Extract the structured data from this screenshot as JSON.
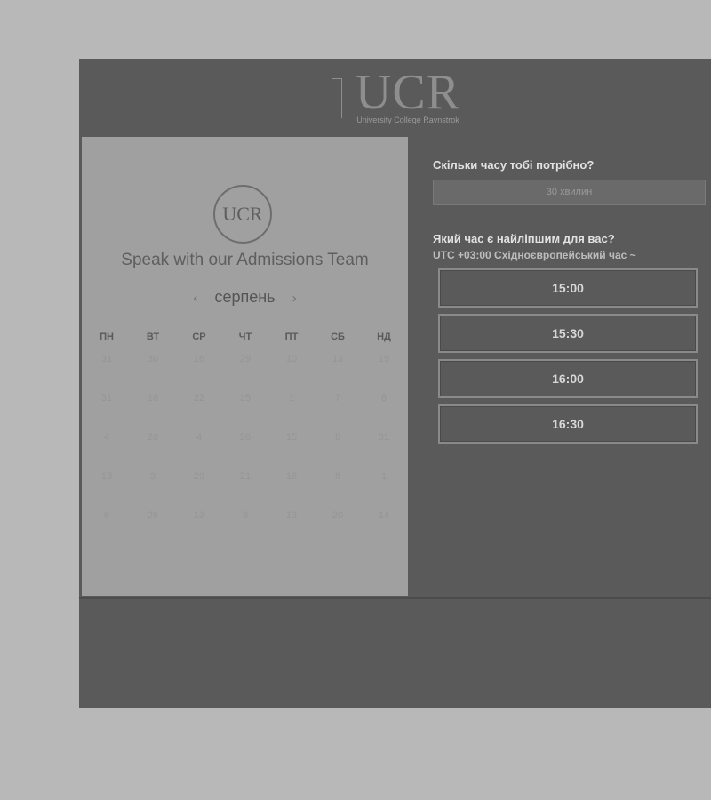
{
  "header": {
    "logo_text": "UCR",
    "logo_subtitle": "University College Ravnstrok"
  },
  "calendar": {
    "logo_text": "UCR",
    "title": "Speak with our Admissions Team",
    "month": "серпень",
    "prev_label": "‹",
    "next_label": "›",
    "weekdays": [
      "ПН",
      "ВТ",
      "СР",
      "ЧТ",
      "ПТ",
      "СБ",
      "НД"
    ],
    "days": [
      [
        "31",
        "30",
        "16",
        "29",
        "10",
        "13",
        "19"
      ],
      [
        "31",
        "16",
        "22",
        "25",
        "1",
        "7",
        "8"
      ],
      [
        "4",
        "20",
        "4",
        "26",
        "15",
        "6",
        "31"
      ],
      [
        "13",
        "3",
        "29",
        "21",
        "16",
        "8",
        "1"
      ],
      [
        "6",
        "26",
        "13",
        "8",
        "13",
        "20",
        "14"
      ]
    ]
  },
  "booking": {
    "duration_question": "Скільки часу тобі потрібно?",
    "duration_value": "30 хвилин",
    "time_question": "Який час є найліпшим для вас?",
    "timezone": "UTC +03:00 Східноєвропейський час",
    "timezone_arrow": "~",
    "slots": [
      "15:00",
      "15:30",
      "16:00",
      "16:30"
    ]
  }
}
